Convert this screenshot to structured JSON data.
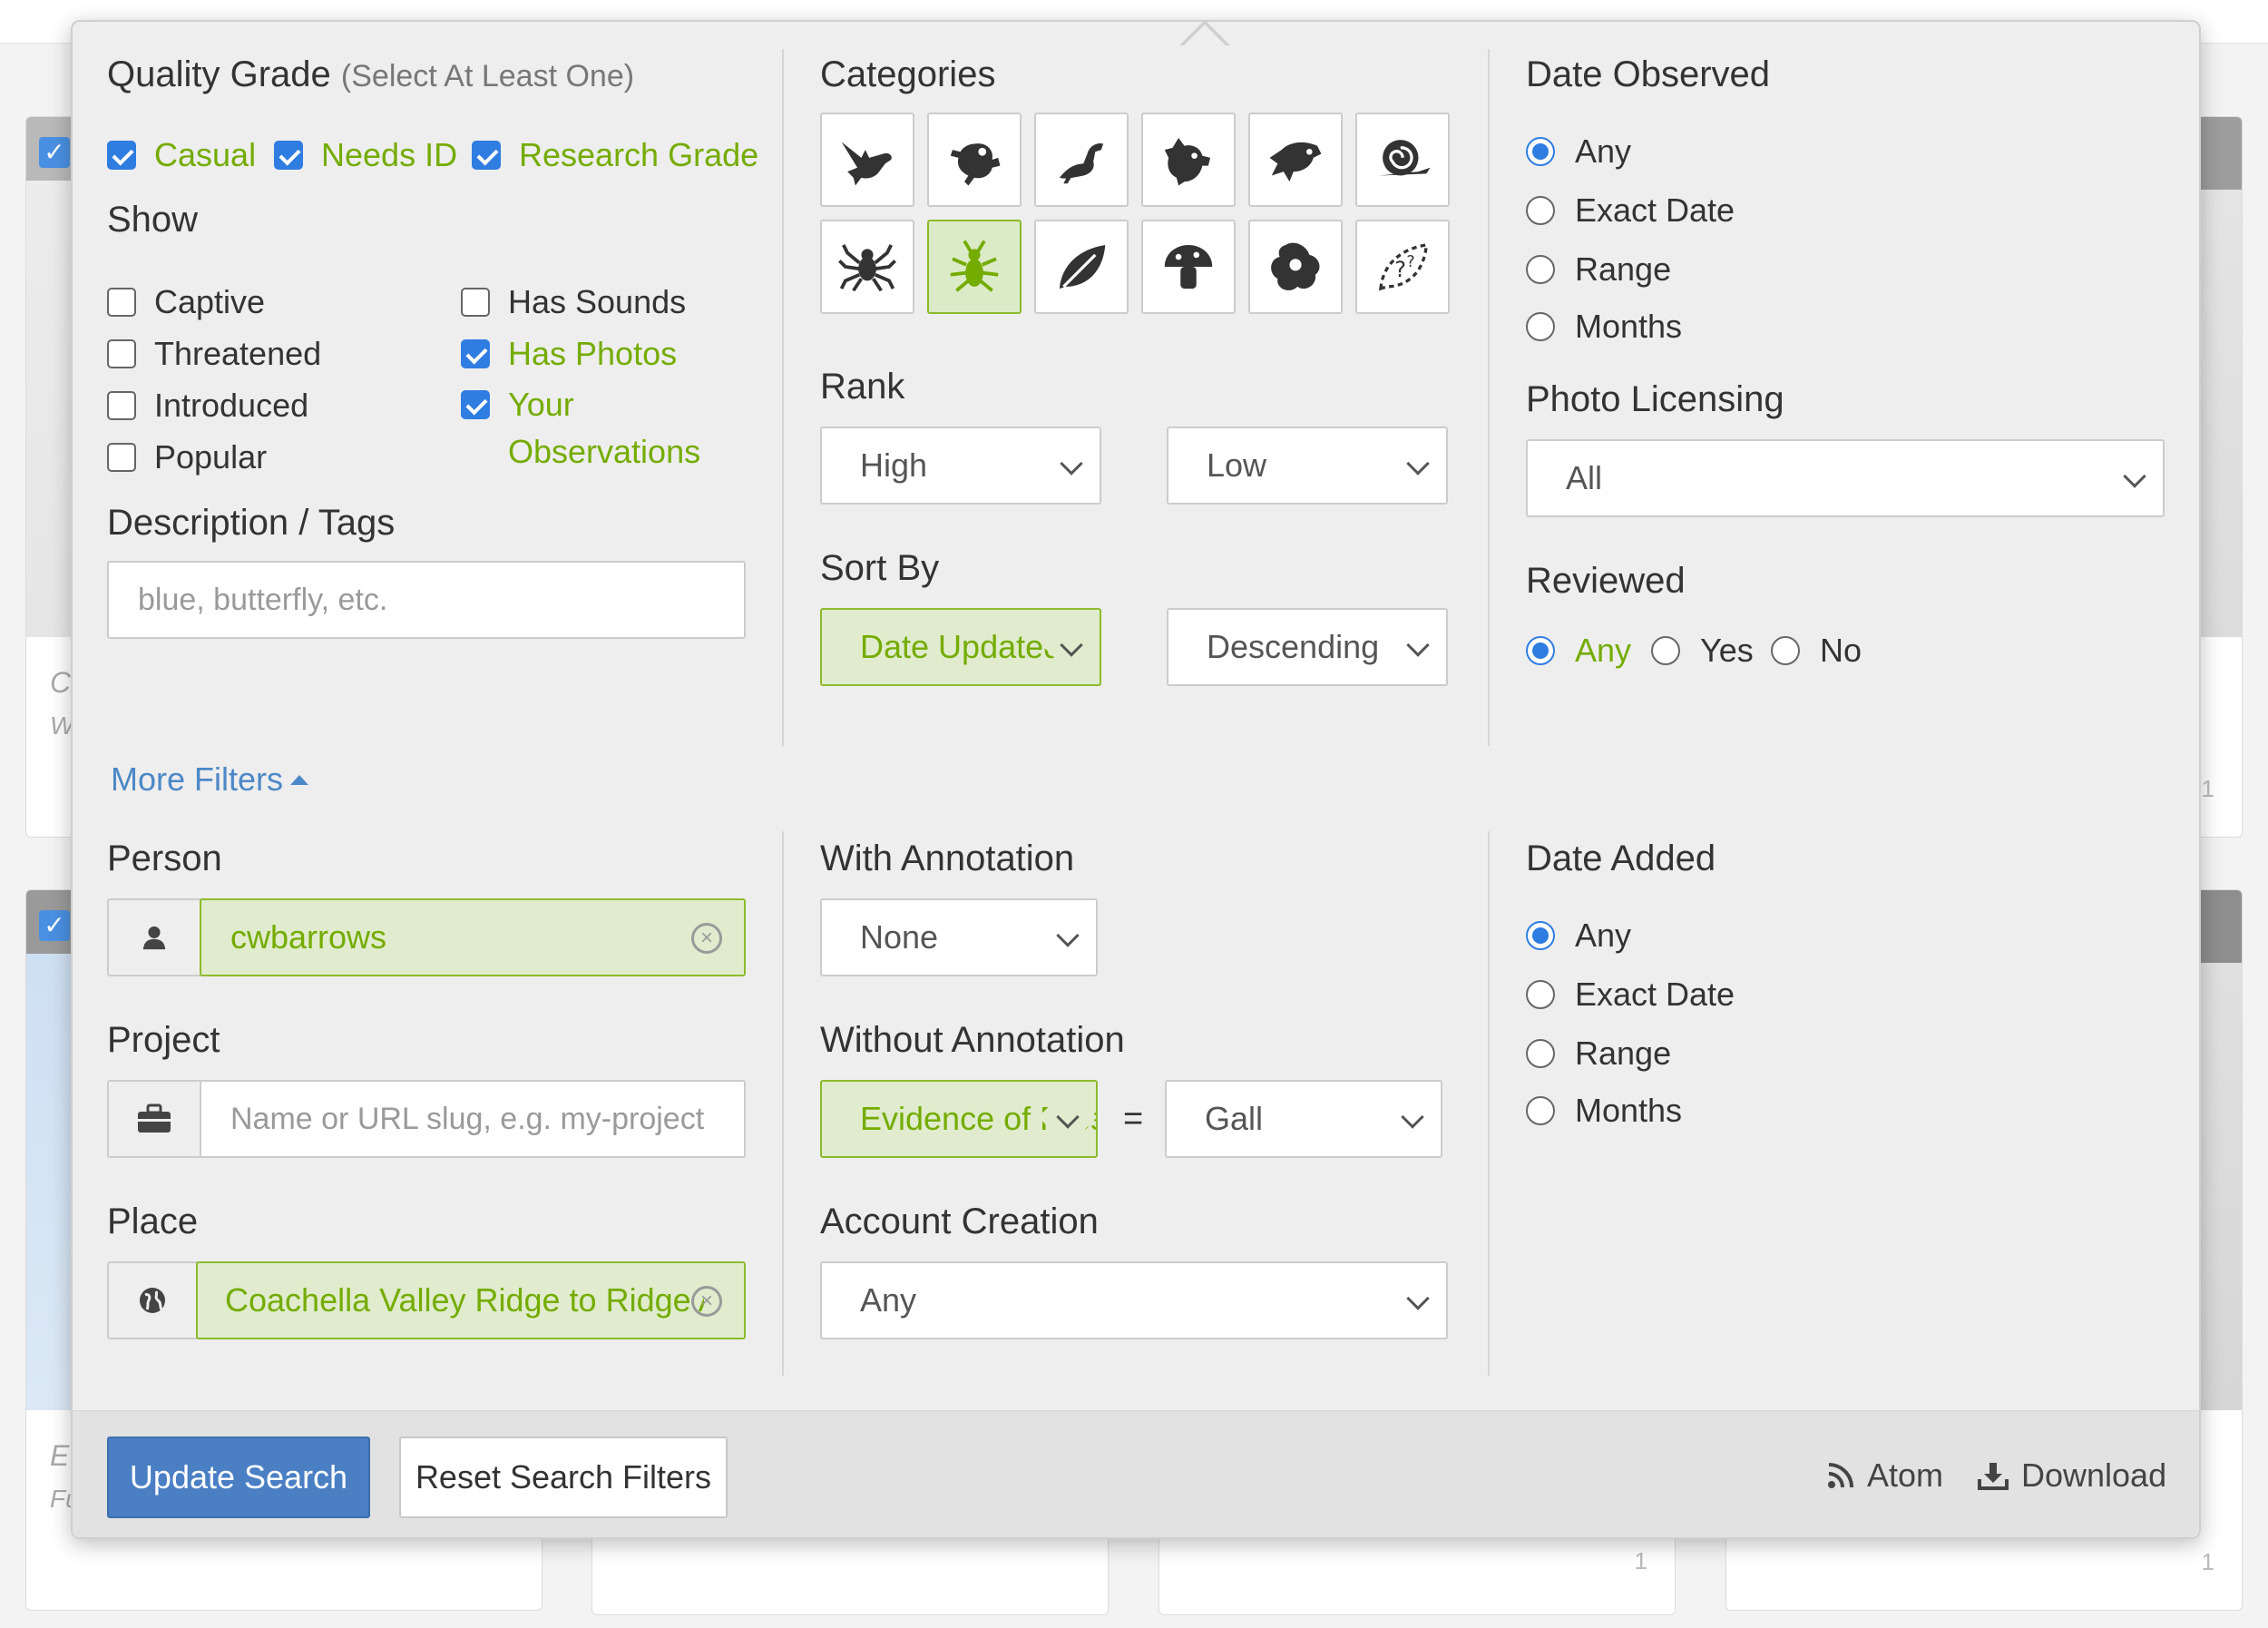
{
  "quality_grade": {
    "title": "Quality Grade",
    "subtitle": "(Select At Least One)",
    "options": [
      {
        "label": "Casual",
        "checked": true
      },
      {
        "label": "Needs ID",
        "checked": true
      },
      {
        "label": "Research Grade",
        "checked": true
      }
    ]
  },
  "show": {
    "title": "Show",
    "options": [
      {
        "label": "Captive",
        "checked": false
      },
      {
        "label": "Threatened",
        "checked": false
      },
      {
        "label": "Introduced",
        "checked": false
      },
      {
        "label": "Popular",
        "checked": false
      },
      {
        "label": "Has Sounds",
        "checked": false
      },
      {
        "label": "Has Photos",
        "checked": true
      },
      {
        "label": "Your",
        "label2": "Observations",
        "checked": true
      }
    ]
  },
  "description_tags": {
    "title": "Description / Tags",
    "placeholder": "blue, butterfly, etc."
  },
  "categories": {
    "title": "Categories",
    "icons": [
      "bird-icon",
      "amphibian-icon",
      "reptile-icon",
      "mammal-icon",
      "fish-icon",
      "mollusk-icon",
      "spider-icon",
      "insect-icon",
      "plant-icon",
      "fungi-icon",
      "protozoa-icon",
      "unknown-icon"
    ],
    "selected": "insect-icon"
  },
  "rank": {
    "title": "Rank",
    "high": "High",
    "low": "Low"
  },
  "sort_by": {
    "title": "Sort By",
    "field": "Date Updated",
    "order": "Descending"
  },
  "date_observed": {
    "title": "Date Observed",
    "options": [
      "Any",
      "Exact Date",
      "Range",
      "Months"
    ],
    "selected": "Any"
  },
  "photo_licensing": {
    "title": "Photo Licensing",
    "value": "All"
  },
  "reviewed": {
    "title": "Reviewed",
    "options": [
      "Any",
      "Yes",
      "No"
    ],
    "selected": "Any"
  },
  "more_filters": "More Filters",
  "person": {
    "title": "Person",
    "value": "cwbarrows"
  },
  "project": {
    "title": "Project",
    "placeholder": "Name or URL slug, e.g. my-project"
  },
  "place": {
    "title": "Place",
    "value": "Coachella Valley Ridge to Ridge Area"
  },
  "with_annotation": {
    "title": "With Annotation",
    "value": "None"
  },
  "without_annotation": {
    "title": "Without Annotation",
    "attribute": "Evidence of Presence",
    "equals": "=",
    "value": "Gall"
  },
  "account_creation": {
    "title": "Account Creation",
    "value": "Any"
  },
  "date_added": {
    "title": "Date Added",
    "options": [
      "Any",
      "Exact Date",
      "Range",
      "Months"
    ],
    "selected": "Any"
  },
  "footer": {
    "update_search": "Update Search",
    "reset_filters": "Reset Search Filters",
    "atom": "Atom",
    "download": "Download"
  },
  "background": {
    "card_letters": [
      "C",
      "W",
      "E",
      "Fu"
    ],
    "counts": [
      "1",
      "1",
      "1"
    ]
  },
  "colors": {
    "accent_green": "#74ac00",
    "primary_blue": "#4a7fc4",
    "checkbox_blue": "#2f7de1"
  }
}
